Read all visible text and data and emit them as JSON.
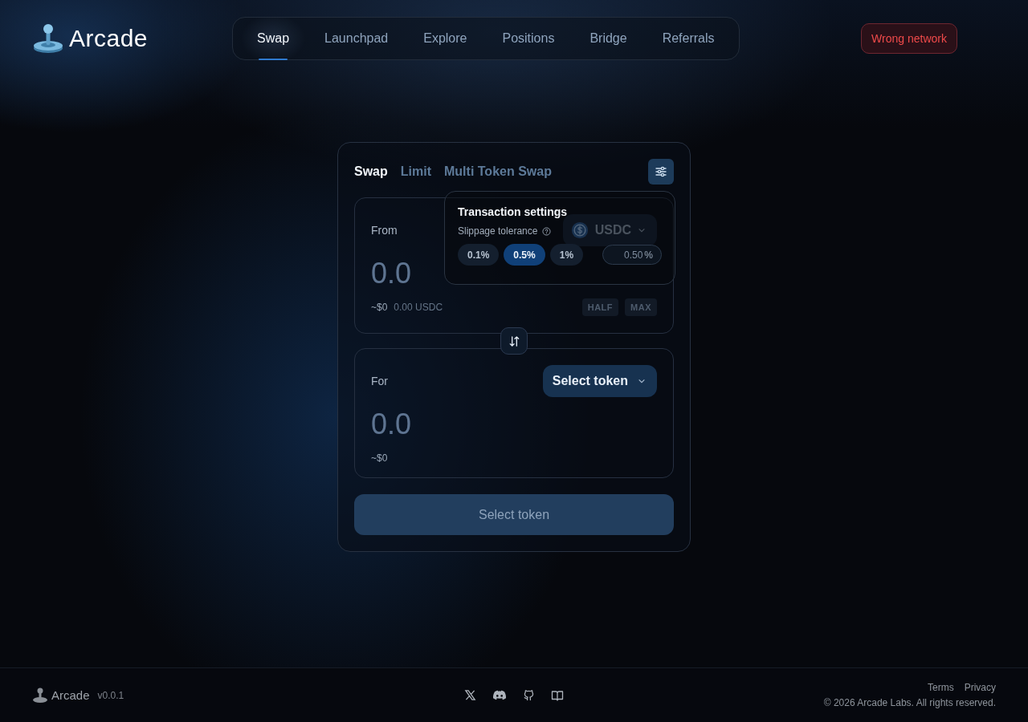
{
  "brand": {
    "name": "Arcade"
  },
  "nav": [
    {
      "label": "Swap",
      "selected": true
    },
    {
      "label": "Launchpad",
      "selected": false
    },
    {
      "label": "Explore",
      "selected": false
    },
    {
      "label": "Positions",
      "selected": false
    },
    {
      "label": "Bridge",
      "selected": false
    },
    {
      "label": "Referrals",
      "selected": false
    }
  ],
  "network_button": "Wrong network",
  "swap_card": {
    "tabs": [
      {
        "label": "Swap",
        "selected": true
      },
      {
        "label": "Limit",
        "selected": false
      },
      {
        "label": "Multi Token Swap",
        "selected": false
      }
    ],
    "from": {
      "label": "From",
      "token": "USDC",
      "placeholder": "0.0",
      "usd": "~$0",
      "balance": "0.00 USDC",
      "quick_buttons": [
        "HALF",
        "MAX"
      ]
    },
    "to": {
      "label": "For",
      "token_button": "Select token",
      "placeholder": "0.0",
      "usd": "~$0"
    },
    "submit": {
      "label": "Select token",
      "disabled": true
    },
    "settings": {
      "title": "Transaction settings",
      "slippage_label": "Slippage tolerance",
      "options": [
        {
          "label": "0.1%",
          "selected": false
        },
        {
          "label": "0.5%",
          "selected": true
        },
        {
          "label": "1%",
          "selected": false
        }
      ],
      "custom": {
        "value": "0.50",
        "unit": "%"
      }
    }
  },
  "footer": {
    "brand": "Arcade",
    "version": "v0.0.1",
    "links": [
      "Terms",
      "Privacy"
    ],
    "copyright": "© 2026 Arcade Labs. All rights reserved."
  }
}
